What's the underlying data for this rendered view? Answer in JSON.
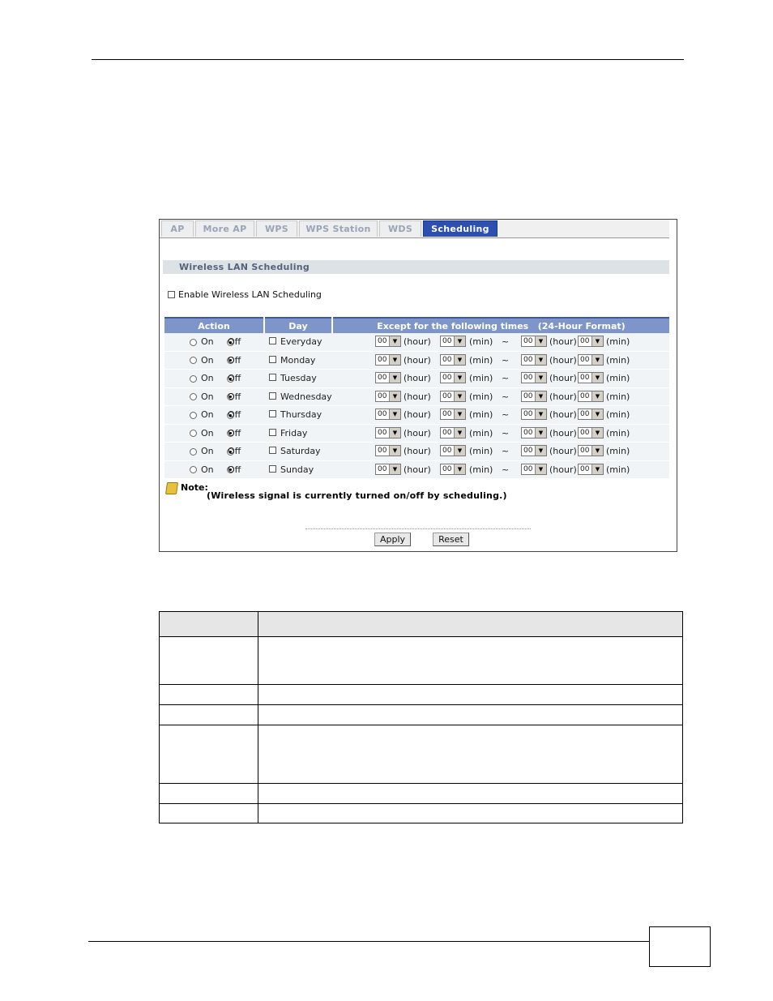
{
  "tabs": [
    "AP",
    "More AP",
    "WPS",
    "WPS Station",
    "WDS",
    "Scheduling"
  ],
  "active_tab": "Scheduling",
  "section_title": "Wireless LAN Scheduling",
  "enable_label": "Enable Wireless LAN Scheduling",
  "table_headers": {
    "action": "Action",
    "day": "Day",
    "times": "Except for the following times   (24-Hour Format)"
  },
  "radio_labels": {
    "on": "On",
    "off": "Off"
  },
  "units": {
    "hour": "(hour)",
    "min": "(min)",
    "tilde": "~"
  },
  "time_default": "00",
  "days": [
    "Everyday",
    "Monday",
    "Tuesday",
    "Wednesday",
    "Thursday",
    "Friday",
    "Saturday",
    "Sunday"
  ],
  "note_label": "Note:",
  "note_text": "(Wireless signal is currently turned on/off by scheduling.)",
  "buttons": {
    "apply": "Apply",
    "reset": "Reset"
  }
}
